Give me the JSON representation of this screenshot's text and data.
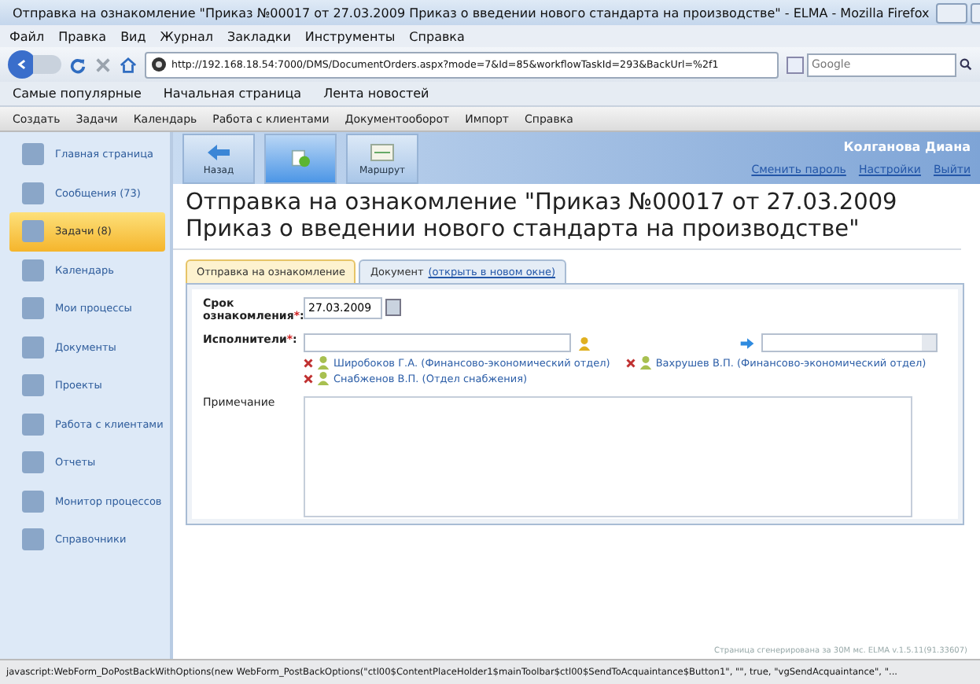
{
  "window": {
    "title": "Отправка на ознакомление \"Приказ №00017 от 27.03.2009 Приказ о введении нового стандарта на производстве\" - ELMA - Mozilla Firefox"
  },
  "menu": [
    "Файл",
    "Правка",
    "Вид",
    "Журнал",
    "Закладки",
    "Инструменты",
    "Справка"
  ],
  "address": {
    "value": "http://192.168.18.54:7000/DMS/DocumentOrders.aspx?mode=7&Id=85&workflowTaskId=293&BackUrl=%2f1"
  },
  "search": {
    "placeholder": "Google"
  },
  "bookmarks": [
    "Самые популярные",
    "Начальная страница",
    "Лента новостей"
  ],
  "app_menu": [
    "Создать",
    "Задачи",
    "Календарь",
    "Работа с клиентами",
    "Документооборот",
    "Импорт",
    "Справка"
  ],
  "sidebar": {
    "items": [
      {
        "label": "Главная страница",
        "selected": false
      },
      {
        "label": "Сообщения (73)",
        "selected": false
      },
      {
        "label": "Задачи (8)",
        "selected": true
      },
      {
        "label": "Календарь",
        "selected": false
      },
      {
        "label": "Мои процессы",
        "selected": false
      },
      {
        "label": "Документы",
        "selected": false
      },
      {
        "label": "Проекты",
        "selected": false
      },
      {
        "label": "Работа с клиентами",
        "selected": false
      },
      {
        "label": "Отчеты",
        "selected": false
      },
      {
        "label": "Монитор процессов",
        "selected": false
      },
      {
        "label": "Справочники",
        "selected": false
      }
    ]
  },
  "toolbar": [
    {
      "label": "Назад",
      "kind": "back",
      "selected": false
    },
    {
      "kind": "send",
      "selected": true
    },
    {
      "label": "Маршрут",
      "kind": "route",
      "selected": false
    }
  ],
  "user": {
    "name": "Колганова Диана",
    "links": [
      "Сменить пароль",
      "Настройки",
      "Выйти"
    ]
  },
  "page_title": "Отправка на ознакомление \"Приказ №00017 от 27.03.2009 Приказ о введении нового стандарта на производстве\"",
  "tabs": [
    {
      "label": "Отправка на ознакомление",
      "selected": true
    },
    {
      "label": "Документ",
      "link": "(открыть в новом окне)",
      "selected": false
    }
  ],
  "form": {
    "due_label": "Срок ознакомления",
    "due_value": "27.03.2009",
    "required_mark": "*",
    "colon": ":",
    "performers_label": "Исполнители",
    "performers": [
      "Широбоков Г.А. (Финансово-экономический отдел)",
      "Вахрушев В.П. (Финансово-экономический отдел)",
      "Снабженов В.П. (Отдел снабжения)"
    ],
    "note_label": "Примечание"
  },
  "footer": "Страница сгенерирована за 30М мс. ELMA v.1.5.11(91.33607)",
  "status_bar": "javascript:WebForm_DoPostBackWithOptions(new WebForm_PostBackOptions(\"ctl00$ContentPlaceHolder1$mainToolbar$ctl00$SendToAcquaintance$Button1\", \"\", true, \"vgSendAcquaintance\", \"..."
}
